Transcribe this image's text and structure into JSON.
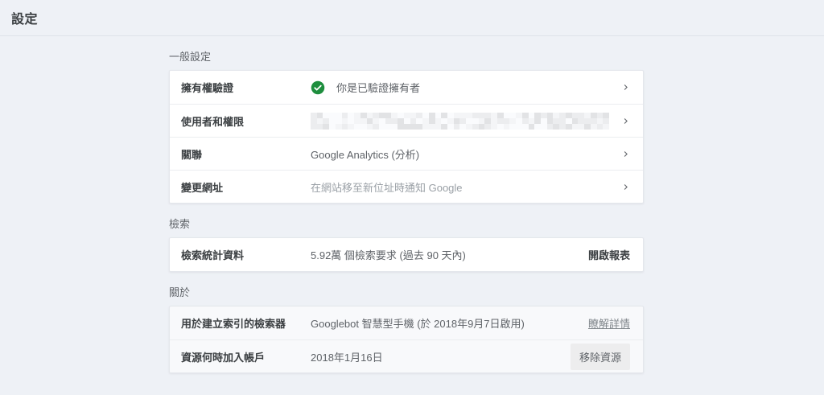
{
  "page": {
    "title": "設定"
  },
  "colors": {
    "page_background": "#eef1f6",
    "card_background": "#ffffff",
    "muted_card_background": "#f8f9fb",
    "label_text": "#3c4043",
    "value_text": "#5f6368",
    "muted_value_text": "#9aa0a6",
    "verified_green": "#1e8e3e",
    "chevron_gray": "#5f6368"
  },
  "sections": [
    {
      "label": "一般設定",
      "rows": [
        {
          "label": "擁有權驗證",
          "value": "你是已驗證擁有者",
          "icon": "verified-check-icon"
        },
        {
          "label": "使用者和權限",
          "value_redacted": true
        },
        {
          "label": "關聯",
          "value": "Google Analytics (分析)"
        },
        {
          "label": "變更網址",
          "value": "在網站移至新位址時通知 Google"
        }
      ]
    },
    {
      "label": "檢索",
      "rows": [
        {
          "label": "檢索統計資料",
          "value": "5.92萬 個檢索要求 (過去 90 天內)",
          "action_label": "開啟報表"
        }
      ]
    },
    {
      "label": "關於",
      "rows": [
        {
          "label": "用於建立索引的檢索器",
          "value": "Googlebot 智慧型手機 (於 2018年9月7日啟用)",
          "action_label": "瞭解詳情"
        },
        {
          "label": "資源何時加入帳戶",
          "value": "2018年1月16日",
          "action_label": "移除資源"
        }
      ]
    }
  ]
}
